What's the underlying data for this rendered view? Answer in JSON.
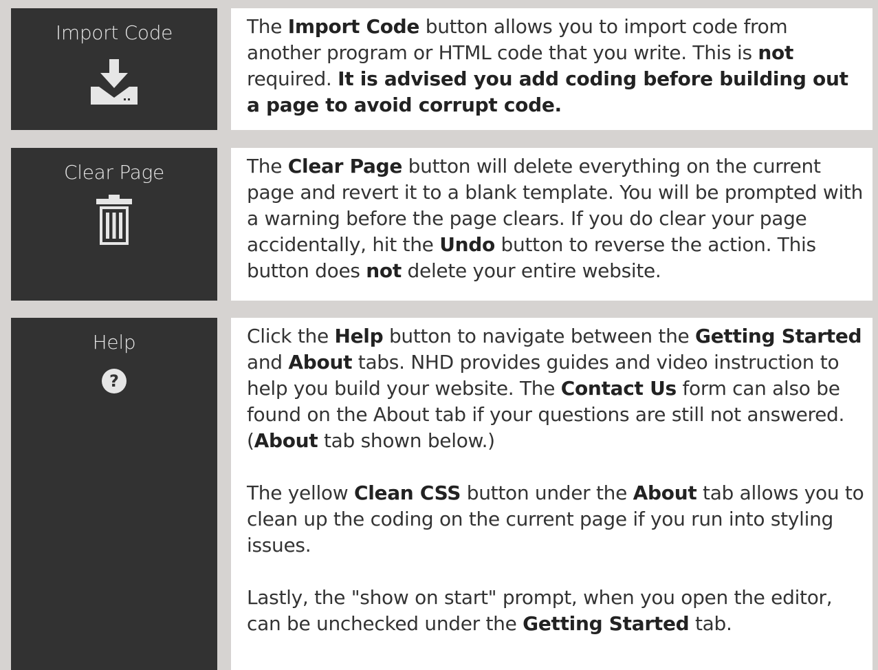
{
  "rows": [
    {
      "title": "Import Code",
      "icon": "download-icon",
      "desc": [
        {
          "t": "The "
        },
        {
          "b": "Import Code"
        },
        {
          "t": " button allows you to import code from another program or HTML code that you write. This is "
        },
        {
          "b": "not"
        },
        {
          "t": " required. "
        },
        {
          "b": "It is advised you add coding before building out a page to avoid corrupt code."
        }
      ]
    },
    {
      "title": "Clear Page",
      "icon": "trash-icon",
      "desc": [
        {
          "t": "The "
        },
        {
          "b": "Clear Page"
        },
        {
          "t": " button will delete everything on the current page and revert it to a blank template. You will be prompted with a warning before the page clears. If you do clear your page accidentally, hit the "
        },
        {
          "b": "Undo"
        },
        {
          "t": " button to reverse the action. This button does "
        },
        {
          "b": "not"
        },
        {
          "t": " delete your entire website."
        }
      ]
    },
    {
      "title": "Help",
      "icon": "help-icon",
      "paragraphs": [
        [
          {
            "t": "Click the "
          },
          {
            "b": "Help"
          },
          {
            "t": " button to navigate between the "
          },
          {
            "b": "Getting Started"
          },
          {
            "t": " and "
          },
          {
            "b": "About"
          },
          {
            "t": " tabs. NHD provides guides and video instruction to help you build your website. The "
          },
          {
            "b": "Contact Us"
          },
          {
            "t": " form can also be found on the About tab if your questions are still not answered. ("
          },
          {
            "b": "About"
          },
          {
            "t": " tab shown below.)"
          }
        ],
        [
          {
            "t": "The yellow "
          },
          {
            "b": "Clean CSS"
          },
          {
            "t": " button under the "
          },
          {
            "b": "About"
          },
          {
            "t": " tab allows you to clean up the coding on the current page if you run into styling issues."
          }
        ],
        [
          {
            "t": "Lastly, the \"show on start\" prompt, when you open the editor, can be unchecked under the "
          },
          {
            "b": "Getting Started"
          },
          {
            "t": " tab."
          }
        ]
      ]
    }
  ],
  "colors": {
    "left_cell": "#323232",
    "right_cell": "#ffffff",
    "border": "#d6d3d1",
    "icon": "#e6e6e6"
  }
}
